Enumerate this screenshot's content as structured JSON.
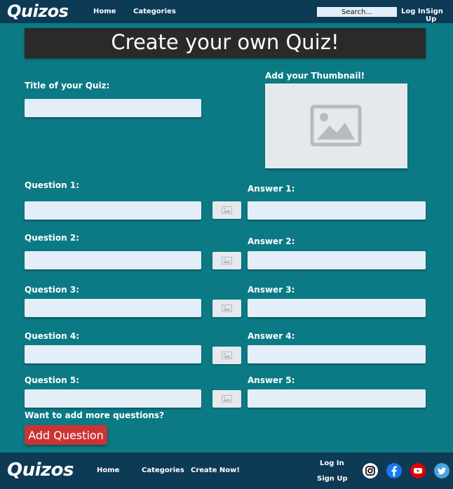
{
  "nav": {
    "logo": "Quizos",
    "home": "Home",
    "categories": "Categories",
    "search_placeholder": "Search...",
    "login": "Log In",
    "signup": "Sign Up"
  },
  "page": {
    "title": "Create your own Quiz!",
    "quiz_title_label": "Title of your Quiz:",
    "thumbnail_label": "Add your Thumbnail!",
    "more_questions_label": "Want to add more questions?",
    "add_question_button": "Add Question"
  },
  "questions": [
    {
      "question_label": "Question 1:",
      "answer_label": "Answer 1:"
    },
    {
      "question_label": "Question 2:",
      "answer_label": "Answer 2:"
    },
    {
      "question_label": "Question 3:",
      "answer_label": "Answer 3:"
    },
    {
      "question_label": "Question 4:",
      "answer_label": "Answer 4:"
    },
    {
      "question_label": "Question 5:",
      "answer_label": "Answer 5:"
    }
  ],
  "footer": {
    "logo": "Quizos",
    "home": "Home",
    "categories": "Categories",
    "create": "Create Now!",
    "login": "Log In",
    "signup": "Sign Up",
    "social_icons": [
      "instagram-icon",
      "facebook-icon",
      "youtube-icon",
      "twitter-icon"
    ]
  },
  "colors": {
    "background": "#0b7a85",
    "nav": "#0d3a55",
    "banner": "#2a2a2a",
    "field": "#e4eef8",
    "accent_button": "#cc3333"
  }
}
